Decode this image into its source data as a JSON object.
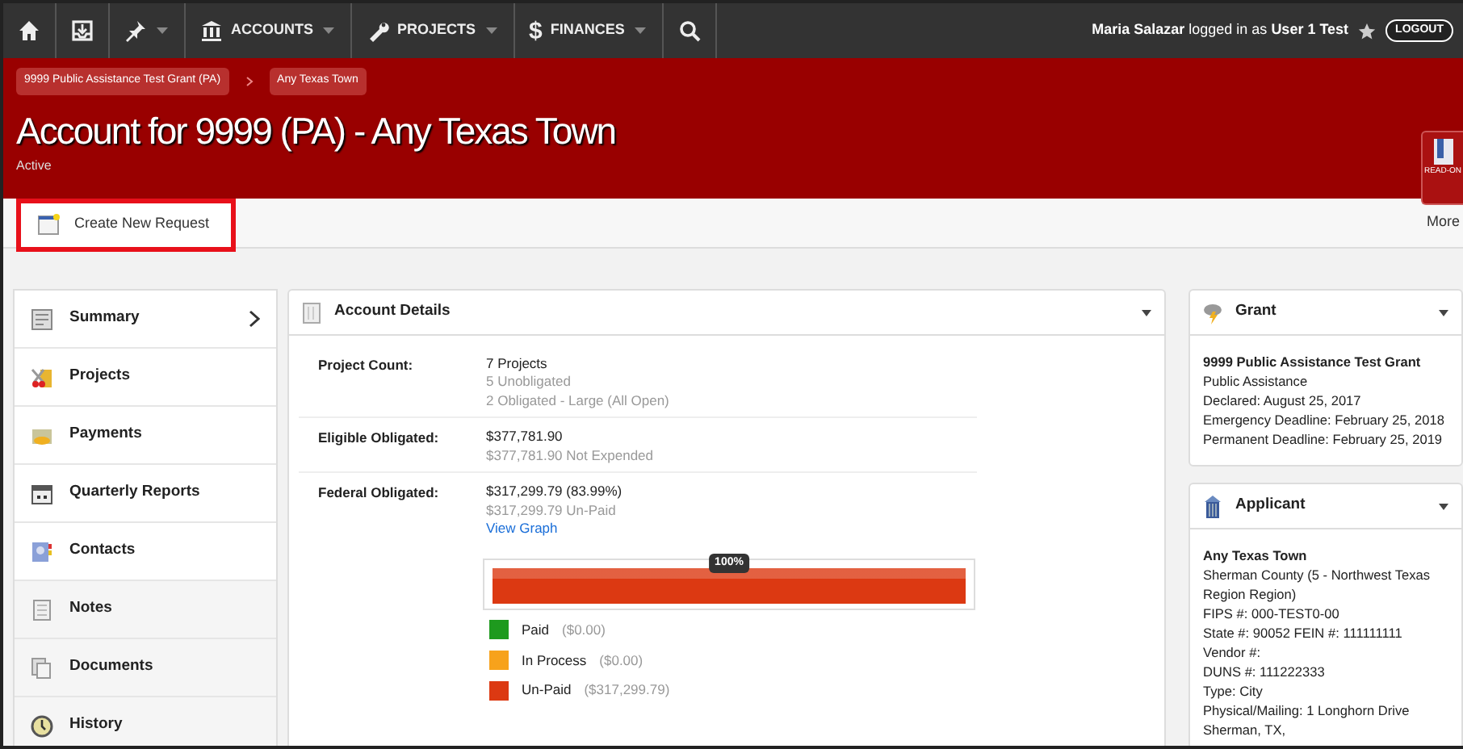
{
  "navbar": {
    "items": [
      {
        "kind": "home",
        "dropdown": false
      },
      {
        "kind": "inbox",
        "dropdown": false
      },
      {
        "kind": "pin",
        "dropdown": true
      },
      {
        "kind": "bank",
        "label": "ACCOUNTS",
        "dropdown": true
      },
      {
        "kind": "wrench",
        "label": "PROJECTS",
        "dropdown": true
      },
      {
        "kind": "dollar",
        "glyph": "$",
        "label": "FINANCES",
        "dropdown": true
      },
      {
        "kind": "search",
        "dropdown": false
      }
    ],
    "user_text": "**Maria Salazar** logged in as **User 1 Test**",
    "logout": "LOGOUT"
  },
  "header": {
    "breadcrumbs": [
      "9999 Public Assistance Test Grant (PA)",
      "Any Texas Town"
    ],
    "title": "Account for 9999 (PA) - Any Texas Town",
    "status": "Active",
    "side_button": "READ-ON"
  },
  "toolbar": {
    "create_button": "Create New Request",
    "more": "More"
  },
  "sidebar": {
    "items": [
      {
        "label": "Summary",
        "kind": "summary",
        "selected": true
      },
      {
        "label": "Projects",
        "kind": "projects",
        "selected": false
      },
      {
        "label": "Payments",
        "kind": "payments",
        "selected": false
      },
      {
        "label": "Quarterly Reports",
        "kind": "calendar",
        "selected": false
      },
      {
        "label": "Contacts",
        "kind": "contacts",
        "selected": false
      },
      {
        "label": "Notes",
        "kind": "notes",
        "selected": false
      },
      {
        "label": "Documents",
        "kind": "documents",
        "selected": false
      },
      {
        "label": "History",
        "kind": "history",
        "selected": false
      }
    ]
  },
  "account_details": {
    "title": "Account Details",
    "rows": [
      {
        "label": "Project Count:",
        "value": "7 Projects",
        "details": [
          "5 Unobligated",
          "2 Obligated - Large (All Open)"
        ]
      },
      {
        "label": "Eligible Obligated:",
        "value": "$377,781.90",
        "details": [
          "$377,781.90 Not Expended"
        ]
      },
      {
        "label": "Federal Obligated:",
        "value": "$317,299.79 (83.99%)",
        "details": [
          "$317,299.79 Un-Paid"
        ],
        "link": "View Graph"
      }
    ],
    "progress": {
      "tooltip": "100%",
      "segments": [
        {
          "label": "Paid",
          "amount": "($0.00)",
          "color": "#1e9a1e",
          "level": 0
        },
        {
          "label": "In Process",
          "amount": "($0.00)",
          "color": "#f7a21b",
          "level": 0
        },
        {
          "label": "Un-Paid",
          "amount": "($317,299.79)",
          "color": "#dc3912",
          "level": 1
        }
      ]
    }
  },
  "grant": {
    "title": "Grant",
    "name": "9999 Public Assistance Test Grant",
    "lines": [
      "Public Assistance",
      "Declared: August 25, 2017",
      "Emergency Deadline: February 25, 2018",
      "Permanent Deadline: February 25, 2019"
    ]
  },
  "applicant": {
    "title": "Applicant",
    "name": "Any Texas Town",
    "lines": [
      "Sherman County (5 - Northwest Texas Region Region)",
      "FIPS #: 000-TEST0-00",
      "State #: 90052 FEIN #: 111111111",
      "Vendor #:",
      "DUNS #: 111222333",
      "Type: City",
      "Physical/Mailing: 1 Longhorn Drive",
      "Sherman, TX,"
    ]
  }
}
